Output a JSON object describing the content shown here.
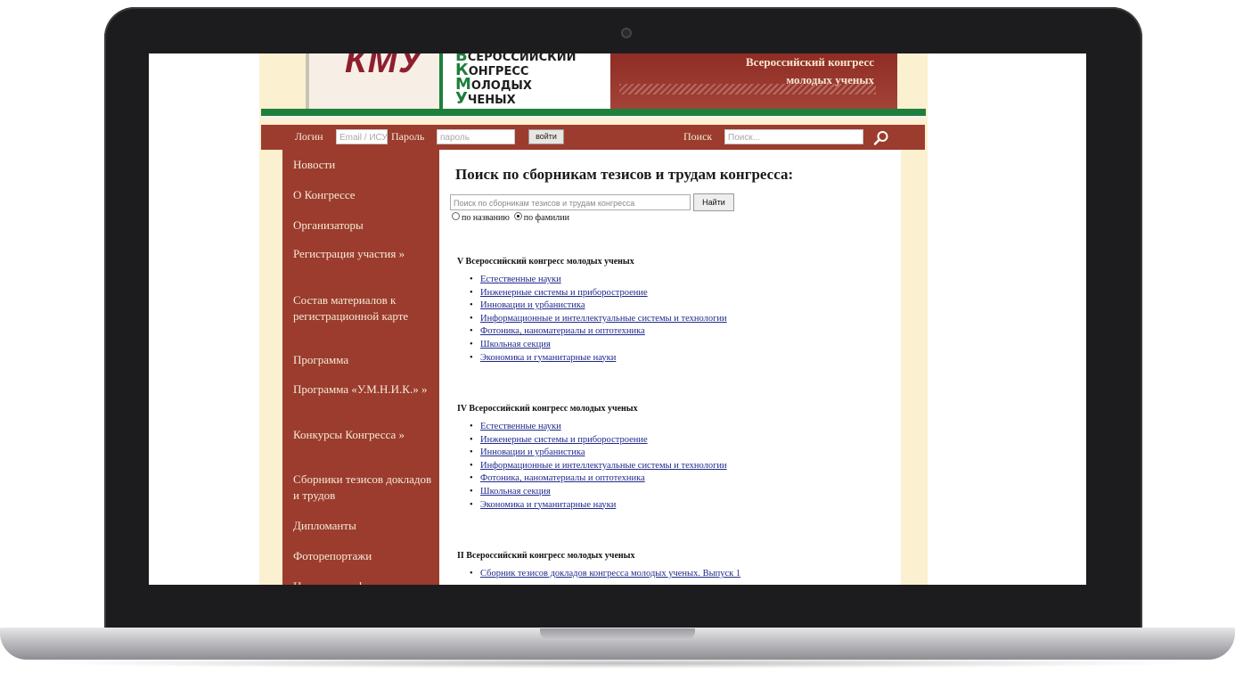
{
  "header": {
    "logo_text": "КМУ",
    "congress_lines": [
      {
        "cap": "В",
        "rest": "СЕРОССИЙСКИЙ"
      },
      {
        "cap": "К",
        "rest": "ОНГРЕСС"
      },
      {
        "cap": "М",
        "rest": "ОЛОДЫХ"
      },
      {
        "cap": "У",
        "rest": "ЧЕНЫХ"
      }
    ],
    "right_line1": "Всероссийский конгресс",
    "right_line2": "молодых ученых"
  },
  "loginbar": {
    "login_label": "Логин",
    "login_placeholder": "Email / ИСУ логин",
    "password_label": "Пароль",
    "password_placeholder": "пароль",
    "login_button": "войти",
    "search_label": "Поиск",
    "search_placeholder": "Поиск..."
  },
  "sidebar": {
    "items": [
      "Новости",
      "О Конгрессе",
      "Организаторы",
      "Регистрация участия »",
      "Состав материалов к регистрационной карте",
      "Программа",
      "Программа «У.М.Н.И.К.» »",
      "Конкурсы Конгресса »",
      "Сборники тезисов докладов и трудов",
      "Дипломанты",
      "Фоторепортажи",
      "Научные конференции"
    ]
  },
  "main": {
    "title": "Поиск по сборникам тезисов и трудам конгресса:",
    "search_placeholder": "Поиск по сборникам тезисов и трудам конгресса",
    "search_button": "Найти",
    "radio_by_title": "по названию",
    "radio_by_surname": "по фамилии",
    "sections": [
      {
        "title": "V Всероссийский конгресс молодых ученых",
        "links": [
          "Естественные науки",
          "Инженерные системы и приборостроение",
          "Инновации и урбанистика",
          "Информационные и интеллектуальные системы и технологии",
          "Фотоника, наноматериалы и оптотехника",
          "Школьная секция",
          "Экономика и гуманитарные науки"
        ]
      },
      {
        "title": "IV Всероссийский конгресс молодых ученых",
        "links": [
          "Естественные науки",
          "Инженерные системы и приборостроение",
          "Инновации и урбанистика",
          "Информационные и интеллектуальные системы и технологии",
          "Фотоника, наноматериалы и оптотехника",
          "Школьная секция",
          "Экономика и гуманитарные науки"
        ]
      },
      {
        "title": "II Всероссийский конгресс молодых ученых",
        "links": [
          "Сборник тезисов докладов конгресса молодых ученых. Выпуск 1"
        ]
      }
    ]
  },
  "colors": {
    "brand_red": "#9b3c2e",
    "brand_green": "#1e7f3c",
    "page_cream": "#fbf0cf",
    "link_blue": "#1f2a8c"
  }
}
